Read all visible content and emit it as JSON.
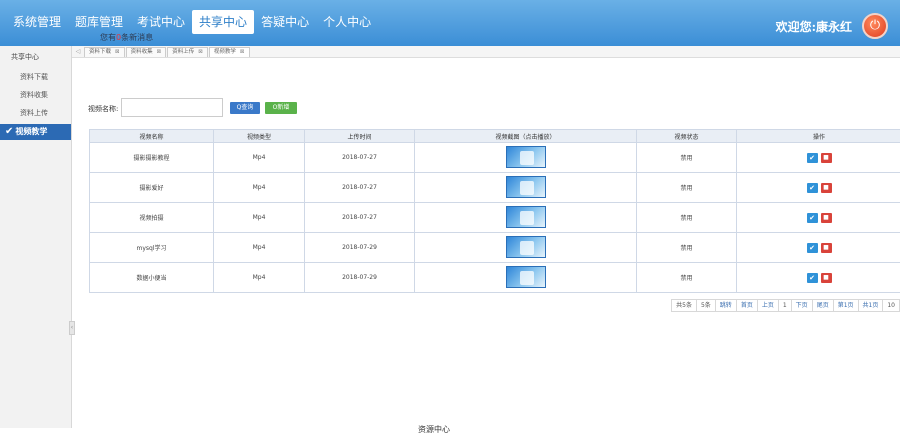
{
  "header": {
    "nav": [
      "系统管理",
      "题库管理",
      "考试中心",
      "共享中心",
      "答疑中心",
      "个人中心"
    ],
    "active_index": 3,
    "notice_prefix": "您有",
    "notice_count": "0",
    "notice_suffix": "条新消息",
    "welcome": "欢迎您:康永红",
    "power_icon": "power-icon",
    "colors": {
      "header_top": "#6ab0e6",
      "header_bottom": "#3b8ed6",
      "power": "#e03b1f"
    }
  },
  "sidebar": {
    "title": "共享中心",
    "items": [
      "资料下载",
      "资料收集",
      "资料上传",
      "视频教学"
    ],
    "active_index": 3,
    "active_color": "#2c6ab4"
  },
  "tabs": [
    "资料下载",
    "资料收集",
    "资料上传",
    "视频教学"
  ],
  "search": {
    "label": "视频名称:",
    "value": "",
    "query_label": "Q查询",
    "add_label": "O新增"
  },
  "table": {
    "columns": [
      "视频名称",
      "视频类型",
      "上传时间",
      "视频截图（点击播放）",
      "视频状态",
      "操作"
    ],
    "rows": [
      {
        "name": "摄影摄影教程",
        "type": "Mp4",
        "date": "2018-07-27",
        "status": "禁用"
      },
      {
        "name": "摄影爱好",
        "type": "Mp4",
        "date": "2018-07-27",
        "status": "禁用"
      },
      {
        "name": "视频拍摄",
        "type": "Mp4",
        "date": "2018-07-27",
        "status": "禁用"
      },
      {
        "name": "mysql学习",
        "type": "Mp4",
        "date": "2018-07-29",
        "status": "禁用"
      },
      {
        "name": "数据小便当",
        "type": "Mp4",
        "date": "2018-07-29",
        "status": "禁用"
      }
    ]
  },
  "pager": {
    "items": [
      "共5条",
      "5条",
      "跳转",
      "首页",
      "上页",
      "1",
      "下页",
      "尾页",
      "第1页",
      "共1页",
      "10"
    ]
  },
  "footer": {
    "text": "资源中心"
  }
}
